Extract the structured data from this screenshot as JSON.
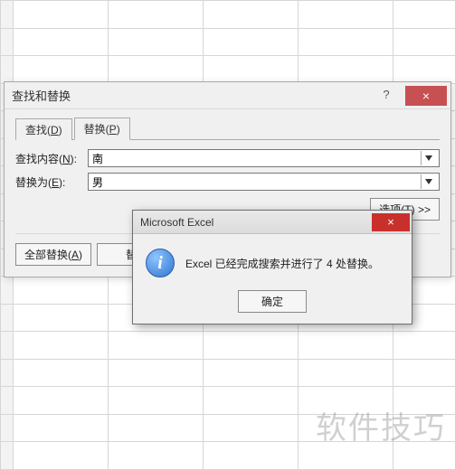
{
  "find_replace": {
    "title": "查找和替换",
    "help_label": "?",
    "close_label": "×",
    "tabs": {
      "find": {
        "label": "查找(",
        "mnemonic": "D",
        "suffix": ")"
      },
      "replace": {
        "label": "替换(",
        "mnemonic": "P",
        "suffix": ")"
      }
    },
    "active_tab": "replace",
    "fields": {
      "find_what": {
        "label_pre": "查找内容(",
        "mnemonic": "N",
        "label_post": "):",
        "value": "南"
      },
      "replace_with": {
        "label_pre": "替换为(",
        "mnemonic": "E",
        "label_post": "):",
        "value": "男"
      }
    },
    "options_btn": {
      "label_pre": "选项(",
      "mnemonic": "T",
      "label_post": ") >>"
    },
    "actions": {
      "replace_all": {
        "label_pre": "全部替换(",
        "mnemonic": "A",
        "label_post": ")"
      },
      "replace_one": {
        "label_pre": "替",
        "rest_visible": ""
      }
    }
  },
  "msgbox": {
    "title": "Microsoft Excel",
    "close_label": "×",
    "icon_char": "i",
    "message": "Excel 已经完成搜索并进行了 4 处替换。",
    "ok_label": "确定"
  },
  "watermark": "软件技巧"
}
